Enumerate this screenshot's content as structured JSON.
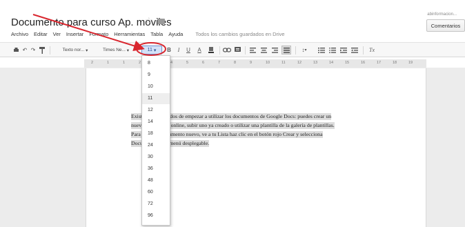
{
  "doc": {
    "title": "Documento para curso Ap. moviles",
    "user_email": "abinformacion...",
    "comments_label": "Comentarios"
  },
  "menu": {
    "items": [
      "Archivo",
      "Editar",
      "Ver",
      "Insertar",
      "Formato",
      "Herramientas",
      "Tabla",
      "Ayuda"
    ],
    "status": "Todos los cambios guardados en Drive"
  },
  "toolbar": {
    "style_label": "Texto nor...",
    "font_label": "Times Ne...",
    "font_size": "11",
    "bold": "B",
    "italic": "I",
    "underline": "U",
    "text_color": "A",
    "clear_format": "Tx"
  },
  "ruler": {
    "ticks": [
      "2",
      "1",
      "1",
      "2",
      "3",
      "4",
      "5",
      "6",
      "7",
      "8",
      "9",
      "10",
      "11",
      "12",
      "13",
      "14",
      "15",
      "16",
      "17",
      "18",
      "19"
    ]
  },
  "document": {
    "lines": [
      "Existen varios modos de empezar a utilizar los documentos de Google Docs: puedes crear un",
      "nuevo documento online, subir uno ya creado o utilizar una plantilla de la galería de plantillas.",
      "Para crear un documento nuevo, ve a tu Lista  haz clic en el botón rojo  Crear y selecciona",
      "Documento en el menú desplegable."
    ]
  },
  "font_size_dropdown": {
    "selected": "11",
    "options": [
      "8",
      "9",
      "10",
      "11",
      "12",
      "14",
      "18",
      "24",
      "30",
      "36",
      "48",
      "60",
      "72",
      "96"
    ]
  },
  "colors": {
    "annotation": "#d9262e",
    "highlight": "#dcdcdc",
    "toolbar_bg": "#f7f7f7"
  },
  "icons": [
    "print-icon",
    "undo-icon",
    "redo-icon",
    "paint-format-icon",
    "link-icon",
    "comment-icon",
    "align-left-icon",
    "align-center-icon",
    "align-right-icon",
    "justify-icon",
    "line-spacing-icon",
    "numbered-list-icon",
    "bulleted-list-icon",
    "decrease-indent-icon",
    "increase-indent-icon",
    "clear-formatting-icon",
    "star-icon",
    "folder-icon"
  ]
}
